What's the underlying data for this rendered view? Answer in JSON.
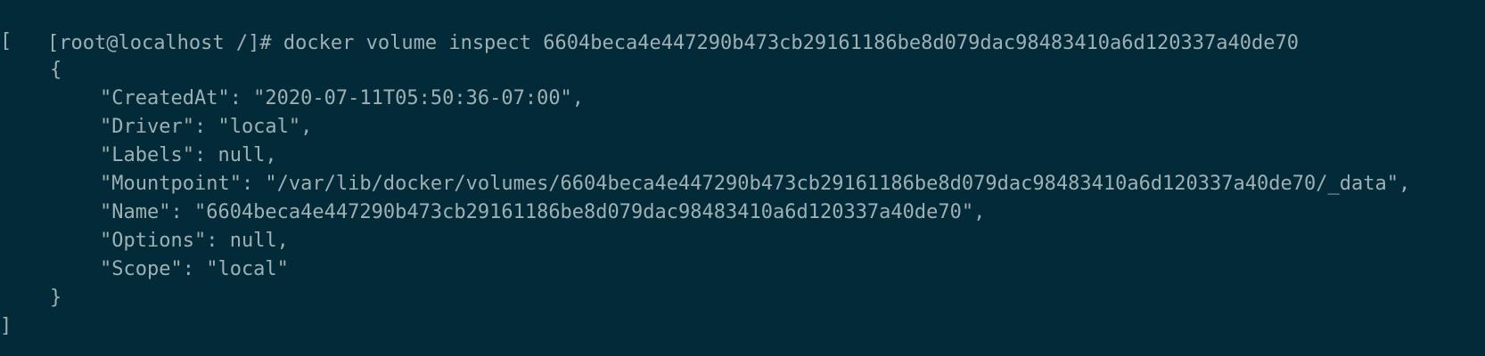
{
  "terminal": {
    "prompt": "[root@localhost /]# ",
    "command": "docker volume inspect 6604beca4e447290b473cb29161186be8d079dac98483410a6d120337a40de70",
    "output": {
      "open_bracket": "[",
      "open_brace": "{",
      "lines": [
        "\"CreatedAt\": \"2020-07-11T05:50:36-07:00\",",
        "\"Driver\": \"local\",",
        "\"Labels\": null,",
        "\"Mountpoint\": \"/var/lib/docker/volumes/6604beca4e447290b473cb29161186be8d079dac98483410a6d120337a40de70/_data\",",
        "\"Name\": \"6604beca4e447290b473cb29161186be8d079dac98483410a6d120337a40de70\",",
        "\"Options\": null,",
        "\"Scope\": \"local\""
      ],
      "close_brace": "}",
      "close_bracket": "]"
    }
  },
  "colors": {
    "background": "#022a38",
    "foreground": "#9fb0b3"
  }
}
